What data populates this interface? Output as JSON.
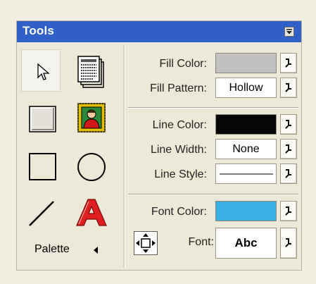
{
  "panel": {
    "title": "Tools",
    "palette_label": "Palette"
  },
  "tools": [
    {
      "name": "pointer-icon"
    },
    {
      "name": "document-icon"
    },
    {
      "name": "raised-button-icon"
    },
    {
      "name": "picture-icon"
    },
    {
      "name": "rectangle-icon"
    },
    {
      "name": "ellipse-icon"
    },
    {
      "name": "line-icon"
    },
    {
      "name": "text-tool-icon"
    }
  ],
  "properties": {
    "fill_color": {
      "label": "Fill Color:",
      "color": "#c2c2c2"
    },
    "fill_pattern": {
      "label": "Fill Pattern:",
      "value": "Hollow"
    },
    "line_color": {
      "label": "Line Color:",
      "color": "#050505"
    },
    "line_width": {
      "label": "Line Width:",
      "value": "None"
    },
    "line_style": {
      "label": "Line Style:"
    },
    "font_color": {
      "label": "Font Color:",
      "color": "#3ab0e6"
    },
    "font": {
      "label": "Font:",
      "value": "Abc"
    }
  },
  "colors": {
    "titlebar": "#3060c8",
    "panel": "#ece9d8"
  }
}
